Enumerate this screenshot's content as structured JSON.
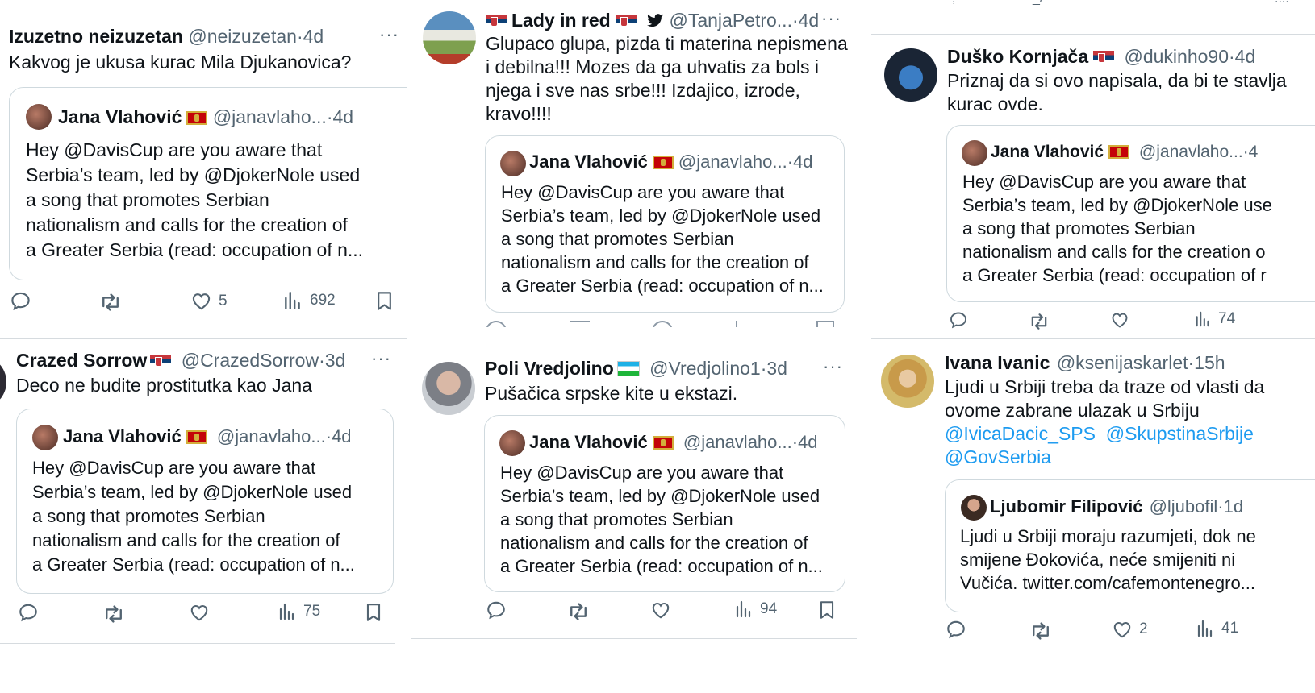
{
  "quoted_tweet": {
    "name": "Jana Vlahović",
    "handle": "@janavlaho...",
    "time": "4d",
    "lines": [
      "Hey @DavisCup are you aware that",
      "Serbia’s team, led by @DjokerNole used",
      "a song that promotes Serbian",
      "nationalism and calls for the creation of",
      "a Greater Serbia (read: occupation of n..."
    ]
  },
  "tweets": [
    {
      "name": "Izuzetno neizuzetan",
      "handle": "@neizuzetan",
      "time": "4d",
      "text": [
        "Kakvog je ukusa kurac Mila Djukanovica?"
      ],
      "likes": "5",
      "views": "692"
    },
    {
      "name": "Lady in red",
      "handle": "@TanjaPetro...",
      "time": "4d",
      "text": [
        "Glupaco glupa, pizda ti materina nepismena",
        "i debilna!!! Mozes da ga uhvatis za bols i",
        "njega i sve nas srbe!!! Izdajico, izrode,",
        "kravo!!!!"
      ]
    },
    {
      "name": "Duško Kornjača",
      "handle": "@dukinho90",
      "time": "4d",
      "text": [
        "Priznaj da si ovo napisala, da bi te stavlja",
        "kurac ovde."
      ],
      "quoted_handle": "@janavlaho...",
      "quoted_time": "4",
      "quoted_lines": [
        "Hey @DavisCup are you aware that",
        "Serbia’s team, led by @DjokerNole use",
        "a song that promotes Serbian",
        "nationalism and calls for the creation o",
        "a Greater Serbia (read: occupation of r"
      ],
      "views": "74"
    },
    {
      "name": "Crazed Sorrow",
      "handle": "@CrazedSorrow",
      "time": "3d",
      "text": [
        "Deco ne budite prostitutka kao Jana"
      ],
      "views": "75"
    },
    {
      "name": "Poli Vredjolino",
      "handle": "@Vredjolino1",
      "time": "3d",
      "text": [
        "Pušačica srpske kite u ekstazi."
      ],
      "views": "94"
    },
    {
      "name": "Ivana Ivanic",
      "handle": "@ksenijaskarlet",
      "time": "15h",
      "text": [
        "Ljudi u Srbiji treba da traze od vlasti da",
        "ovome  zabrane ulazak u Srbiju"
      ],
      "mentions": [
        "@IvicaDacic_SPS",
        "@SkupstinaSrbije",
        "@GovSerbia"
      ],
      "quoted_name": "Ljubomir Filipović",
      "quoted_handle": "@ljubofil",
      "quoted_time": "1d",
      "quoted_lines": [
        "Ljudi u Srbiji moraju razumjeti, dok ne",
        "smijene Đokovića, neće smijeniti ni",
        "Vučića. twitter.com/cafemontenegro..."
      ],
      "likes": "2",
      "views": "41"
    }
  ],
  "icons": [
    "reply-icon",
    "retweet-icon",
    "like-icon",
    "views-icon",
    "bookmark-icon",
    "more-icon",
    "twitter-bird-icon"
  ],
  "colors": {
    "text": "#0f1419",
    "secondary": "#536471",
    "link": "#1d9bf0",
    "border": "#cfd9de"
  }
}
